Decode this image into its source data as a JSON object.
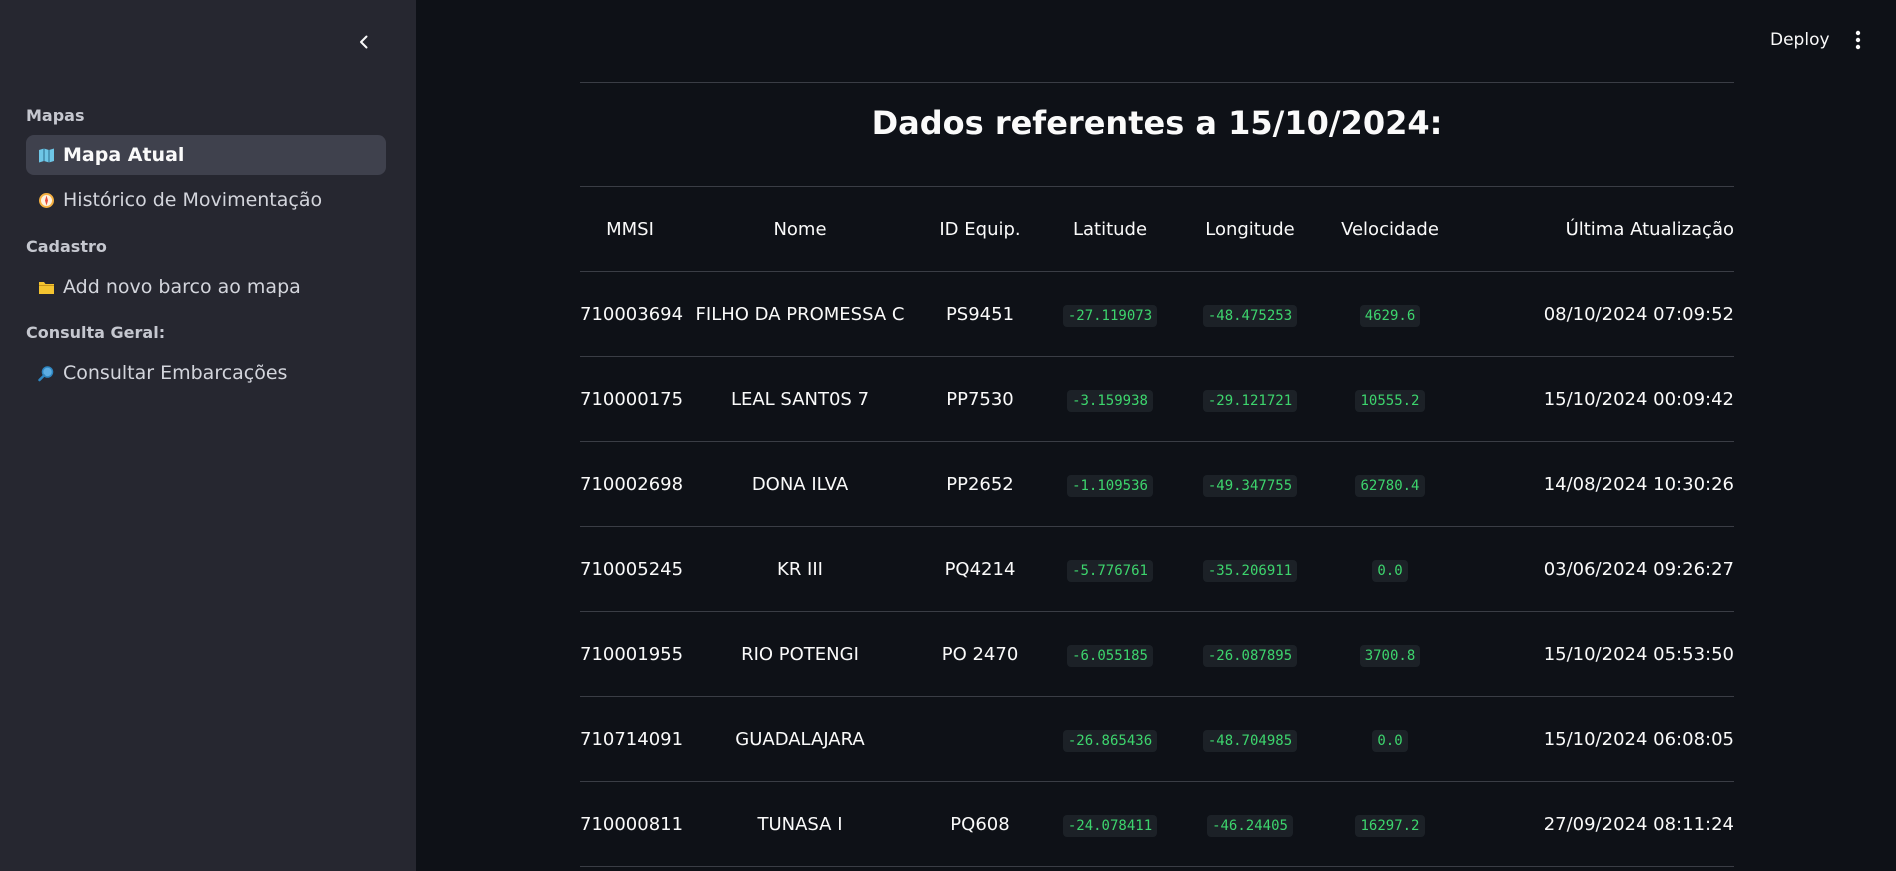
{
  "sidebar": {
    "sections": [
      {
        "label": "Mapas"
      },
      {
        "label": "Cadastro"
      },
      {
        "label": "Consulta Geral:"
      }
    ],
    "items": [
      {
        "label": "Mapa Atual",
        "icon": "map-icon",
        "active": true
      },
      {
        "label": "Histórico de Movimentação",
        "icon": "compass-icon",
        "active": false
      },
      {
        "label": "Add novo barco ao mapa",
        "icon": "folder-icon",
        "active": false
      },
      {
        "label": "Consultar Embarcações",
        "icon": "magnifier-icon",
        "active": false
      }
    ]
  },
  "header": {
    "deploy_label": "Deploy"
  },
  "main": {
    "title": "Dados referentes a 15/10/2024:",
    "table": {
      "columns": [
        "MMSI",
        "Nome",
        "ID Equip.",
        "Latitude",
        "Longitude",
        "Velocidade",
        "Última Atualização"
      ],
      "rows": [
        [
          "710003694",
          "FILHO DA PROMESSA C",
          "PS9451",
          "-27.119073",
          "-48.475253",
          "4629.6",
          "08/10/2024 07:09:52"
        ],
        [
          "710000175",
          "LEAL SANT0S 7",
          "PP7530",
          "-3.159938",
          "-29.121721",
          "10555.2",
          "15/10/2024 00:09:42"
        ],
        [
          "710002698",
          "DONA ILVA",
          "PP2652",
          "-1.109536",
          "-49.347755",
          "62780.4",
          "14/08/2024 10:30:26"
        ],
        [
          "710005245",
          "KR III",
          "PQ4214",
          "-5.776761",
          "-35.206911",
          "0.0",
          "03/06/2024 09:26:27"
        ],
        [
          "710001955",
          "RIO POTENGI",
          "PO 2470",
          "-6.055185",
          "-26.087895",
          "3700.8",
          "15/10/2024 05:53:50"
        ],
        [
          "710714091",
          "GUADALAJARA",
          "",
          "-26.865436",
          "-48.704985",
          "0.0",
          "15/10/2024 06:08:05"
        ],
        [
          "710000811",
          "TUNASA I",
          "PQ608",
          "-24.078411",
          "-46.24405",
          "16297.2",
          "27/09/2024 08:11:24"
        ]
      ]
    }
  },
  "colors": {
    "background": "#0e1117",
    "sidebar": "#262730",
    "active_item": "#3f414d",
    "code_text": "#3dd56d",
    "code_bg": "#1c2127"
  }
}
